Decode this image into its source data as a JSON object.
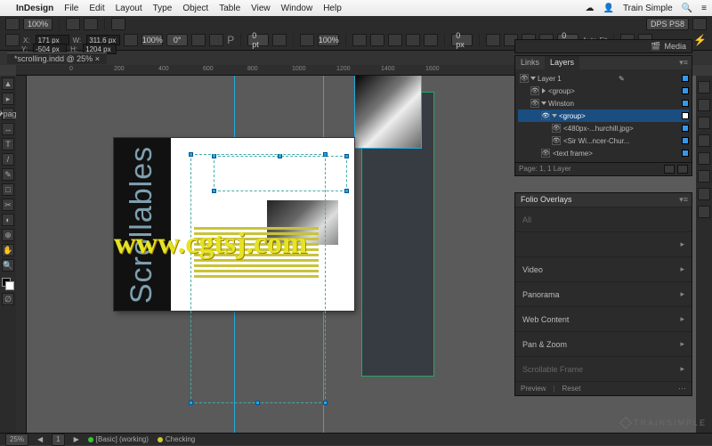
{
  "mac_menu": {
    "app": "InDesign",
    "items": [
      "File",
      "Edit",
      "Layout",
      "Type",
      "Object",
      "Table",
      "View",
      "Window",
      "Help"
    ],
    "right": {
      "cloud": "☁︎",
      "user": "👤",
      "brand": "Train Simple",
      "search": "🔍",
      "list": "≡"
    }
  },
  "workspace_switcher": "DPS PS8",
  "control_bar": {
    "x_label": "X:",
    "x": "171 px",
    "y_label": "Y:",
    "y": "-504 px",
    "w_label": "W:",
    "w": "311.6 px",
    "h_label": "H:",
    "h": "1204 px",
    "zoom": "100%",
    "rot": "0°",
    "pt": "0 pt",
    "px0": "0 px",
    "px1": "0 px",
    "autofit": "Auto-Fit"
  },
  "doc_tab": "*scrolling.indd @ 25%",
  "ruler_labels": [
    "0",
    "200",
    "400",
    "600",
    "800",
    "1000",
    "1200",
    "1400",
    "1600"
  ],
  "artboard": {
    "sidebar_text": "Scrollables"
  },
  "tools": [
    "▲",
    "▸",
    "�page",
    "↔",
    "T",
    "/",
    "✎",
    "□",
    "✂",
    "◐",
    "⊕",
    "✋",
    "🔍",
    "∅"
  ],
  "rightdock": [
    "co",
    "◧",
    "≡",
    "A",
    "fx",
    "¶",
    "□",
    "◩"
  ],
  "media_panel": {
    "title": "Media",
    "icon": "🎬"
  },
  "layers_panel": {
    "tabs": [
      "Links",
      "Layers"
    ],
    "active": 1,
    "rows": [
      {
        "name": "Layer 1",
        "depth": 0,
        "open": true,
        "chip": true,
        "pencil": true
      },
      {
        "name": "<group>",
        "depth": 1,
        "open": false,
        "chip": true
      },
      {
        "name": "Winston",
        "depth": 1,
        "open": true,
        "chip": true
      },
      {
        "name": "<group>",
        "depth": 2,
        "open": true,
        "chip": true,
        "sel": true
      },
      {
        "name": "<480px-...hurchill.jpg>",
        "depth": 3,
        "chip": true
      },
      {
        "name": "<Sir Wi...ncer-Chur...",
        "depth": 3,
        "chip": true
      },
      {
        "name": "<text frame>",
        "depth": 2,
        "chip": true
      }
    ],
    "footer": "Page: 1, 1 Layer"
  },
  "folio_panel": {
    "title": "Folio Overlays",
    "rows": [
      {
        "label": "All",
        "dim": true
      },
      {
        "label": "",
        "dim": true
      },
      {
        "label": "Video"
      },
      {
        "label": "Panorama"
      },
      {
        "label": "Web Content"
      },
      {
        "label": "Pan & Zoom"
      },
      {
        "label": "Scrollable Frame",
        "dim": true
      }
    ],
    "footer": {
      "preview": "Preview",
      "reset": "Reset"
    }
  },
  "status": {
    "zoom": "25%",
    "page": "1",
    "preset": "[Basic] (working)",
    "check": "Checking"
  },
  "watermark": "www.cgtsj.com",
  "brand_footer": "TRAINSIMPLE"
}
